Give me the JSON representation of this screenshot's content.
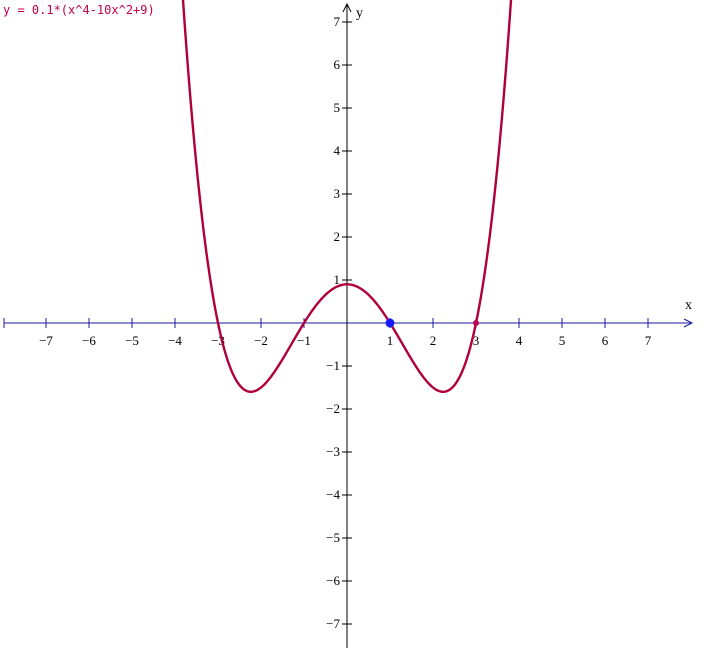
{
  "equation_label": "y = 0.1*(x^4-10x^2+9)",
  "colors": {
    "axis": "#1a1aa6",
    "curve": "#b0003c",
    "point_blue": "#1a1aff",
    "point_red": "#c0004b"
  },
  "chart_data": {
    "type": "line",
    "title": "",
    "xlabel": "x",
    "ylabel": "y",
    "xlim": [
      -8,
      8
    ],
    "ylim": [
      -7.5,
      7.5
    ],
    "x_ticks": [
      -7,
      -6,
      -5,
      -4,
      -3,
      -2,
      -1,
      1,
      2,
      3,
      4,
      5,
      6,
      7
    ],
    "y_ticks": [
      -7,
      -6,
      -5,
      -4,
      -3,
      -2,
      -1,
      1,
      2,
      3,
      4,
      5,
      6,
      7
    ],
    "x_tick_labels": [
      "−7",
      "−6",
      "−5",
      "−4",
      "−3",
      "−2",
      "−1",
      "1",
      "2",
      "3",
      "4",
      "5",
      "6",
      "7"
    ],
    "y_tick_labels": [
      "−7",
      "−6",
      "−5",
      "−4",
      "−3",
      "−2",
      "−1",
      "1",
      "2",
      "3",
      "4",
      "5",
      "6",
      "7"
    ],
    "grid": false,
    "series": [
      {
        "function": "0.1*(x^4-10x^2+9)",
        "x_range": [
          -3.85,
          3.85
        ],
        "x": [
          -3.85,
          -3.5,
          -3.0,
          -2.5,
          -2.24,
          -2.0,
          -1.5,
          -1.0,
          -0.5,
          0.0,
          0.5,
          1.0,
          1.5,
          2.0,
          2.24,
          2.5,
          3.0,
          3.5,
          3.85
        ],
        "y": [
          7.07,
          3.66,
          0.0,
          -1.45,
          -1.6,
          -1.5,
          -0.94,
          0.0,
          0.66,
          0.9,
          0.66,
          0.0,
          -0.94,
          -1.5,
          -1.6,
          -1.45,
          0.0,
          3.66,
          7.07
        ]
      }
    ],
    "points": [
      {
        "x": 1,
        "y": 0,
        "color": "#1a1aff"
      },
      {
        "x": 3,
        "y": 0,
        "color": "#c0004b"
      }
    ]
  }
}
